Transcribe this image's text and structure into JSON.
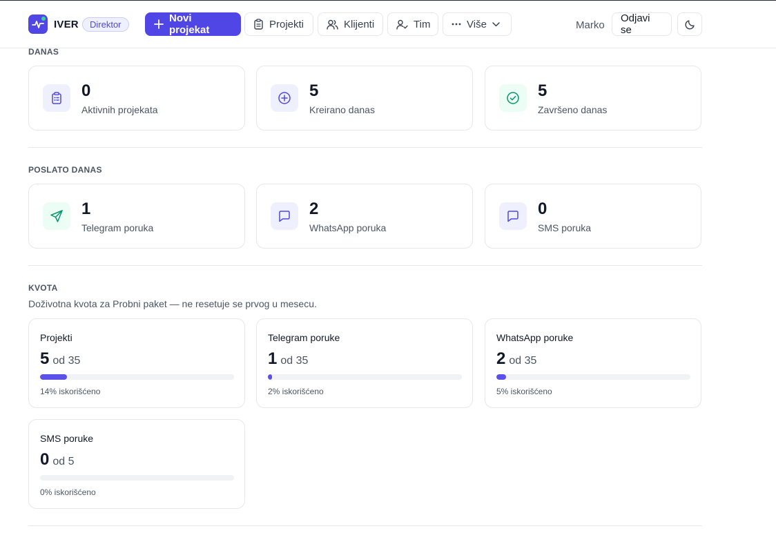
{
  "brand": {
    "name": "IVER",
    "role": "Direktor"
  },
  "nav": {
    "new_project": "Novi projekat",
    "projects": "Projekti",
    "clients": "Klijenti",
    "team": "Tim",
    "more": "Više"
  },
  "user": {
    "name": "Marko",
    "logout": "Odjavi se"
  },
  "today": {
    "title": "DANAS",
    "cards": [
      {
        "value": "0",
        "label": "Aktivnih projekata",
        "icon": "clipboard-icon"
      },
      {
        "value": "5",
        "label": "Kreirano danas",
        "icon": "plus-circle-icon"
      },
      {
        "value": "5",
        "label": "Završeno danas",
        "icon": "check-circle-icon"
      }
    ]
  },
  "sent": {
    "title": "POSLATO DANAS",
    "cards": [
      {
        "value": "1",
        "label": "Telegram poruka",
        "icon": "send-icon"
      },
      {
        "value": "2",
        "label": "WhatsApp poruka",
        "icon": "message-icon"
      },
      {
        "value": "0",
        "label": "SMS poruka",
        "icon": "message-icon"
      }
    ]
  },
  "quota": {
    "title": "KVOTA",
    "subtitle": "Doživotna kvota za Probni paket — ne resetuje se prvog u mesecu.",
    "cards": [
      {
        "title": "Projekti",
        "used": "5",
        "of_text": "od 35",
        "percent": 14,
        "percent_label": "14% iskorišćeno"
      },
      {
        "title": "Telegram poruke",
        "used": "1",
        "of_text": "od 35",
        "percent": 2,
        "percent_label": "2% iskorišćeno"
      },
      {
        "title": "WhatsApp poruke",
        "used": "2",
        "of_text": "od 35",
        "percent": 5,
        "percent_label": "5% iskorišćeno"
      },
      {
        "title": "SMS poruke",
        "used": "0",
        "of_text": "od 5",
        "percent": 0,
        "percent_label": "0% iskorišćeno"
      }
    ]
  },
  "colors": {
    "accent": "#4f46e5",
    "success": "#059669",
    "bar_fill": "#5b50ea",
    "bar_track": "#f1f2f4"
  }
}
